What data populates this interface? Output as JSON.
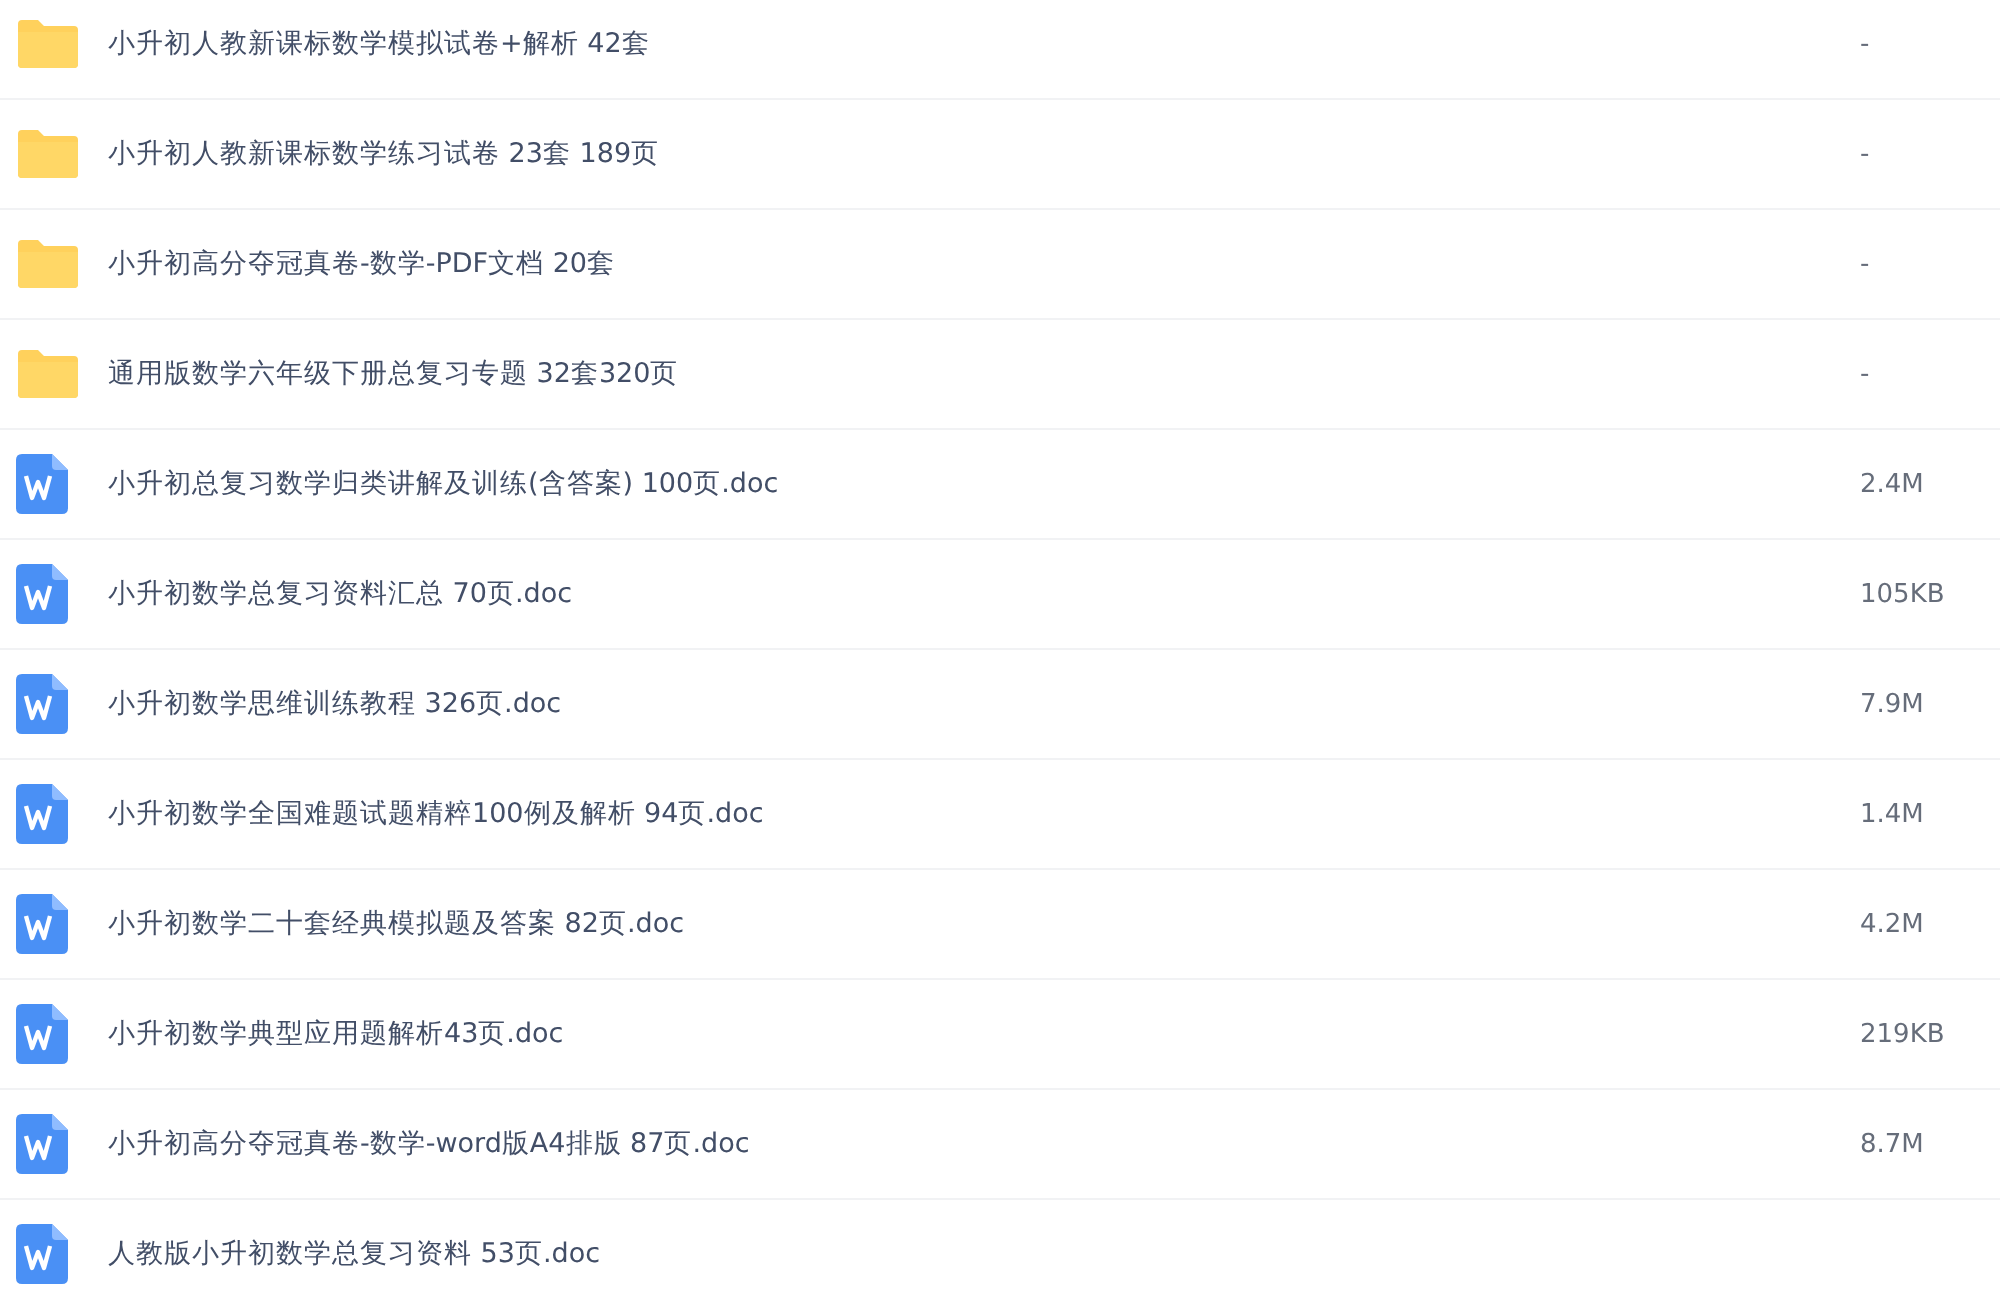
{
  "files": [
    {
      "kind": "folder",
      "name": "小升初人教新课标数学模拟试卷+解析 42套",
      "size": "-"
    },
    {
      "kind": "folder",
      "name": "小升初人教新课标数学练习试卷 23套 189页",
      "size": "-"
    },
    {
      "kind": "folder",
      "name": "小升初高分夺冠真卷-数学-PDF文档 20套",
      "size": "-"
    },
    {
      "kind": "folder",
      "name": "通用版数学六年级下册总复习专题 32套320页",
      "size": "-"
    },
    {
      "kind": "doc",
      "name": "小升初总复习数学归类讲解及训练(含答案) 100页.doc",
      "size": "2.4M"
    },
    {
      "kind": "doc",
      "name": "小升初数学总复习资料汇总 70页.doc",
      "size": "105KB"
    },
    {
      "kind": "doc",
      "name": "小升初数学思维训练教程 326页.doc",
      "size": "7.9M"
    },
    {
      "kind": "doc",
      "name": "小升初数学全国难题试题精粹100例及解析 94页.doc",
      "size": "1.4M"
    },
    {
      "kind": "doc",
      "name": "小升初数学二十套经典模拟题及答案 82页.doc",
      "size": "4.2M"
    },
    {
      "kind": "doc",
      "name": "小升初数学典型应用题解析43页.doc",
      "size": "219KB"
    },
    {
      "kind": "doc",
      "name": "小升初高分夺冠真卷-数学-word版A4排版 87页.doc",
      "size": "8.7M"
    },
    {
      "kind": "doc",
      "name": "人教版小升初数学总复习资料 53页.doc"
    }
  ]
}
